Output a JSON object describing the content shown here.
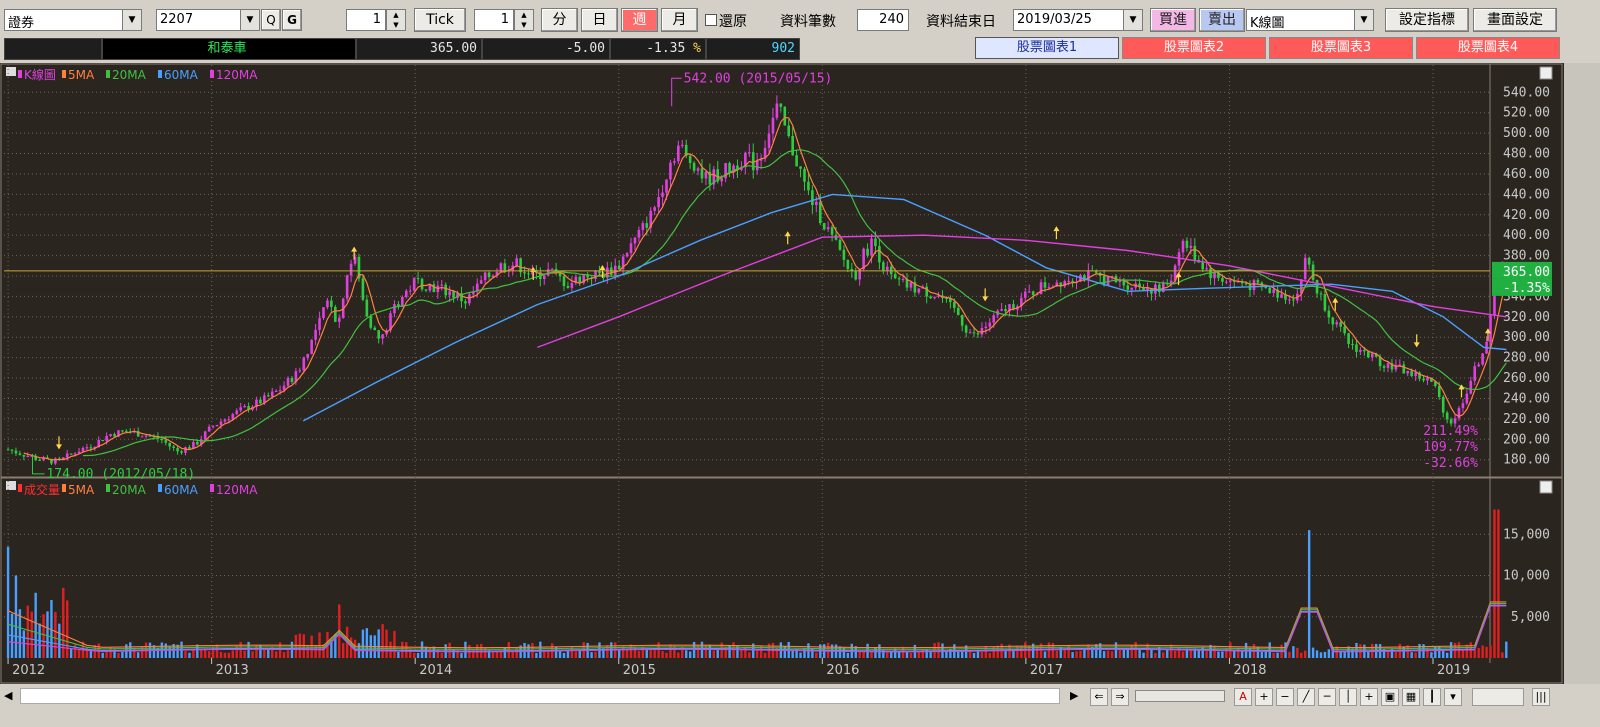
{
  "toolbar": {
    "market": "證券",
    "symbol": "2207",
    "search_btn": "Q",
    "g_btn": "G",
    "tick_value": "1",
    "tick_label": "Tick",
    "period_value": "1",
    "periods": [
      "分",
      "日",
      "週",
      "月"
    ],
    "active_period": "週",
    "restore_label": "還原",
    "record_count_label": "資料筆數",
    "record_count": "240",
    "end_date_label": "資料結束日",
    "end_date": "2019/03/25",
    "buy_label": "買進",
    "sell_label": "賣出",
    "chart_type": "K線圖",
    "indicator_btn": "設定指標",
    "screen_btn": "畫面設定"
  },
  "info": {
    "name": "和泰車",
    "price": "365.00",
    "change": "-5.00",
    "pct": "-1.35",
    "pct_unit": "%",
    "volume": "902"
  },
  "tabs": [
    "股票圖表1",
    "股票圖表2",
    "股票圖表3",
    "股票圖表4"
  ],
  "colors": {
    "bg": "#2b2520",
    "up": "#e040e0",
    "down": "#2ecc40",
    "ma5": "#ff8040",
    "ma20": "#40c040",
    "ma60": "#4aa0ff",
    "ma120": "#e040e0",
    "vol_up": "#e02020",
    "vol_down": "#4aa0ff",
    "grid": "#6e6454",
    "axis_text": "#c8c8c8"
  },
  "chart_data": {
    "type": "candlestick",
    "price_legend": [
      {
        "label": "K線圖",
        "color": "#e040e0"
      },
      {
        "label": "5MA",
        "color": "#ff8040"
      },
      {
        "label": "20MA",
        "color": "#40c040"
      },
      {
        "label": "60MA",
        "color": "#4aa0ff"
      },
      {
        "label": "120MA",
        "color": "#e040e0"
      }
    ],
    "volume_legend": [
      {
        "label": "成交量",
        "color": "#ff3030"
      },
      {
        "label": "5MA",
        "color": "#ff8040"
      },
      {
        "label": "20MA",
        "color": "#40c040"
      },
      {
        "label": "60MA",
        "color": "#4aa0ff"
      },
      {
        "label": "120MA",
        "color": "#e040e0"
      }
    ],
    "x_years": [
      {
        "label": "2012",
        "t": 2012.0
      },
      {
        "label": "2013",
        "t": 2013.0
      },
      {
        "label": "2014",
        "t": 2014.0
      },
      {
        "label": "2015",
        "t": 2015.0
      },
      {
        "label": "2016",
        "t": 2016.0
      },
      {
        "label": "2017",
        "t": 2017.0
      },
      {
        "label": "2018",
        "t": 2018.0
      },
      {
        "label": "2019",
        "t": 2019.0
      }
    ],
    "xlim": [
      2011.98,
      2019.28
    ],
    "y_ticks": [
      540,
      520,
      500,
      480,
      460,
      440,
      420,
      400,
      380,
      360,
      340,
      320,
      300,
      280,
      260,
      240,
      220,
      200,
      180
    ],
    "ylim": [
      165,
      555
    ],
    "vol_ticks": [
      15000,
      10000,
      5000
    ],
    "vol_ylim": [
      0,
      20000
    ],
    "current_price": 365.0,
    "current_price_label": "365.00",
    "current_pct_label": "-1.35%",
    "high_label": "542.00 (2015/05/15)",
    "low_label": "174.00 (2012/05/18)",
    "stats_labels": [
      "211.49%",
      "109.77%",
      "-32.66%"
    ],
    "price_path": [
      [
        2012.0,
        190
      ],
      [
        2012.08,
        185
      ],
      [
        2012.16,
        180
      ],
      [
        2012.25,
        178
      ],
      [
        2012.33,
        188
      ],
      [
        2012.42,
        195
      ],
      [
        2012.5,
        205
      ],
      [
        2012.58,
        208
      ],
      [
        2012.66,
        205
      ],
      [
        2012.75,
        200
      ],
      [
        2012.83,
        188
      ],
      [
        2012.92,
        195
      ],
      [
        2013.0,
        212
      ],
      [
        2013.08,
        222
      ],
      [
        2013.16,
        230
      ],
      [
        2013.25,
        238
      ],
      [
        2013.33,
        248
      ],
      [
        2013.42,
        265
      ],
      [
        2013.5,
        300
      ],
      [
        2013.58,
        340
      ],
      [
        2013.62,
        310
      ],
      [
        2013.66,
        360
      ],
      [
        2013.7,
        380
      ],
      [
        2013.75,
        330
      ],
      [
        2013.8,
        305
      ],
      [
        2013.83,
        295
      ],
      [
        2013.9,
        330
      ],
      [
        2013.96,
        345
      ],
      [
        2014.0,
        355
      ],
      [
        2014.08,
        350
      ],
      [
        2014.16,
        345
      ],
      [
        2014.25,
        335
      ],
      [
        2014.33,
        355
      ],
      [
        2014.42,
        370
      ],
      [
        2014.5,
        372
      ],
      [
        2014.58,
        360
      ],
      [
        2014.66,
        365
      ],
      [
        2014.75,
        352
      ],
      [
        2014.83,
        360
      ],
      [
        2014.92,
        362
      ],
      [
        2015.0,
        370
      ],
      [
        2015.04,
        385
      ],
      [
        2015.08,
        395
      ],
      [
        2015.16,
        420
      ],
      [
        2015.2,
        440
      ],
      [
        2015.25,
        470
      ],
      [
        2015.3,
        490
      ],
      [
        2015.33,
        475
      ],
      [
        2015.38,
        470
      ],
      [
        2015.42,
        455
      ],
      [
        2015.5,
        460
      ],
      [
        2015.58,
        470
      ],
      [
        2015.62,
        478
      ],
      [
        2015.66,
        470
      ],
      [
        2015.7,
        480
      ],
      [
        2015.74,
        505
      ],
      [
        2015.78,
        525
      ],
      [
        2015.8,
        515
      ],
      [
        2015.83,
        495
      ],
      [
        2015.88,
        470
      ],
      [
        2015.92,
        445
      ],
      [
        2015.96,
        430
      ],
      [
        2016.0,
        415
      ],
      [
        2016.04,
        400
      ],
      [
        2016.08,
        385
      ],
      [
        2016.12,
        370
      ],
      [
        2016.16,
        360
      ],
      [
        2016.2,
        380
      ],
      [
        2016.25,
        395
      ],
      [
        2016.3,
        370
      ],
      [
        2016.35,
        355
      ],
      [
        2016.42,
        350
      ],
      [
        2016.5,
        345
      ],
      [
        2016.58,
        340
      ],
      [
        2016.62,
        330
      ],
      [
        2016.66,
        325
      ],
      [
        2016.7,
        310
      ],
      [
        2016.75,
        300
      ],
      [
        2016.8,
        310
      ],
      [
        2016.85,
        320
      ],
      [
        2016.92,
        330
      ],
      [
        2017.0,
        340
      ],
      [
        2017.08,
        350
      ],
      [
        2017.16,
        355
      ],
      [
        2017.25,
        360
      ],
      [
        2017.33,
        360
      ],
      [
        2017.42,
        355
      ],
      [
        2017.5,
        352
      ],
      [
        2017.58,
        350
      ],
      [
        2017.66,
        345
      ],
      [
        2017.72,
        360
      ],
      [
        2017.76,
        395
      ],
      [
        2017.8,
        388
      ],
      [
        2017.85,
        375
      ],
      [
        2017.92,
        360
      ],
      [
        2018.0,
        355
      ],
      [
        2018.08,
        352
      ],
      [
        2018.16,
        348
      ],
      [
        2018.25,
        342
      ],
      [
        2018.33,
        340
      ],
      [
        2018.38,
        380
      ],
      [
        2018.42,
        350
      ],
      [
        2018.5,
        320
      ],
      [
        2018.58,
        295
      ],
      [
        2018.66,
        285
      ],
      [
        2018.75,
        275
      ],
      [
        2018.83,
        270
      ],
      [
        2018.92,
        262
      ],
      [
        2019.0,
        255
      ],
      [
        2019.04,
        235
      ],
      [
        2019.08,
        215
      ],
      [
        2019.12,
        225
      ],
      [
        2019.16,
        245
      ],
      [
        2019.2,
        265
      ],
      [
        2019.24,
        285
      ],
      [
        2019.27,
        300
      ],
      [
        2019.3,
        340
      ],
      [
        2019.33,
        380
      ],
      [
        2019.36,
        365
      ]
    ],
    "ma60_path": [
      [
        2013.45,
        218
      ],
      [
        2013.8,
        255
      ],
      [
        2014.2,
        295
      ],
      [
        2014.6,
        332
      ],
      [
        2015.0,
        360
      ],
      [
        2015.4,
        395
      ],
      [
        2015.75,
        422
      ],
      [
        2016.05,
        440
      ],
      [
        2016.4,
        435
      ],
      [
        2016.8,
        400
      ],
      [
        2017.1,
        368
      ],
      [
        2017.5,
        345
      ],
      [
        2017.9,
        348
      ],
      [
        2018.2,
        350
      ],
      [
        2018.5,
        352
      ],
      [
        2018.8,
        345
      ],
      [
        2019.05,
        320
      ],
      [
        2019.25,
        290
      ],
      [
        2019.36,
        288
      ]
    ],
    "ma120_path": [
      [
        2014.6,
        290
      ],
      [
        2015.0,
        320
      ],
      [
        2015.5,
        360
      ],
      [
        2016.0,
        398
      ],
      [
        2016.5,
        400
      ],
      [
        2017.0,
        395
      ],
      [
        2017.5,
        385
      ],
      [
        2018.0,
        370
      ],
      [
        2018.5,
        350
      ],
      [
        2019.0,
        330
      ],
      [
        2019.36,
        320
      ]
    ],
    "markers": [
      {
        "t": 2012.25,
        "p": 195,
        "dir": "down"
      },
      {
        "t": 2013.7,
        "p": 380,
        "dir": "up"
      },
      {
        "t": 2014.58,
        "p": 360,
        "dir": "up"
      },
      {
        "t": 2014.92,
        "p": 362,
        "dir": "up"
      },
      {
        "t": 2015.83,
        "p": 395,
        "dir": "up"
      },
      {
        "t": 2016.8,
        "p": 340,
        "dir": "down"
      },
      {
        "t": 2017.15,
        "p": 400,
        "dir": "up"
      },
      {
        "t": 2017.75,
        "p": 355,
        "dir": "up"
      },
      {
        "t": 2018.52,
        "p": 330,
        "dir": "up"
      },
      {
        "t": 2018.92,
        "p": 295,
        "dir": "down"
      },
      {
        "t": 2019.14,
        "p": 245,
        "dir": "up"
      },
      {
        "t": 2019.27,
        "p": 300,
        "dir": "up"
      }
    ],
    "vol_spikes": [
      {
        "t": 2012.0,
        "v": 13500
      },
      {
        "t": 2012.04,
        "v": 10000
      },
      {
        "t": 2013.62,
        "v": 6500
      },
      {
        "t": 2018.39,
        "v": 15500
      },
      {
        "t": 2019.31,
        "v": 18000
      }
    ]
  }
}
